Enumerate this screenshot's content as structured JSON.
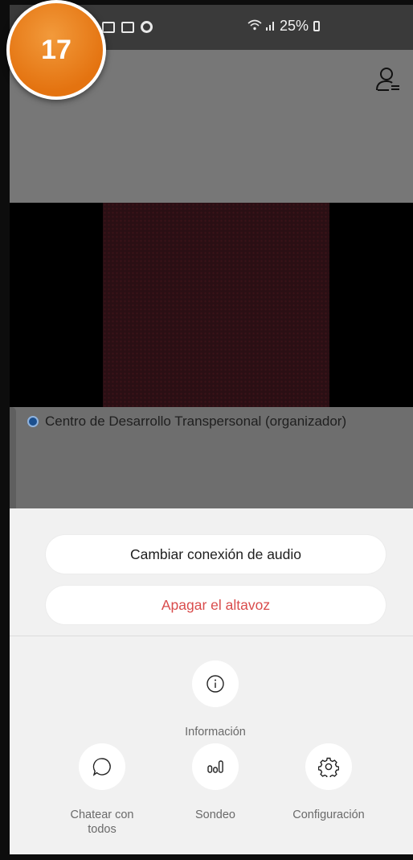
{
  "badge": {
    "number": "17"
  },
  "status_bar": {
    "battery": "25%"
  },
  "participant": {
    "name": "Centro de Desarrollo Transpersonal (organizador)"
  },
  "sheet": {
    "audio_button": "Cambiar conexión de audio",
    "speaker_button": "Apagar el altavoz",
    "actions": {
      "info": "Información",
      "chat": "Chatear con\ntodos",
      "poll": "Sondeo",
      "settings": "Configuración"
    }
  },
  "colors": {
    "badge": "#e47310",
    "danger_text": "#d94c4c",
    "sheet_bg": "#f1f1f1"
  },
  "icons": [
    "image-icon",
    "circle-icon",
    "wifi-icon",
    "signal-icon",
    "battery-icon",
    "participants-icon",
    "info-icon",
    "chat-icon",
    "poll-icon",
    "gear-icon"
  ]
}
